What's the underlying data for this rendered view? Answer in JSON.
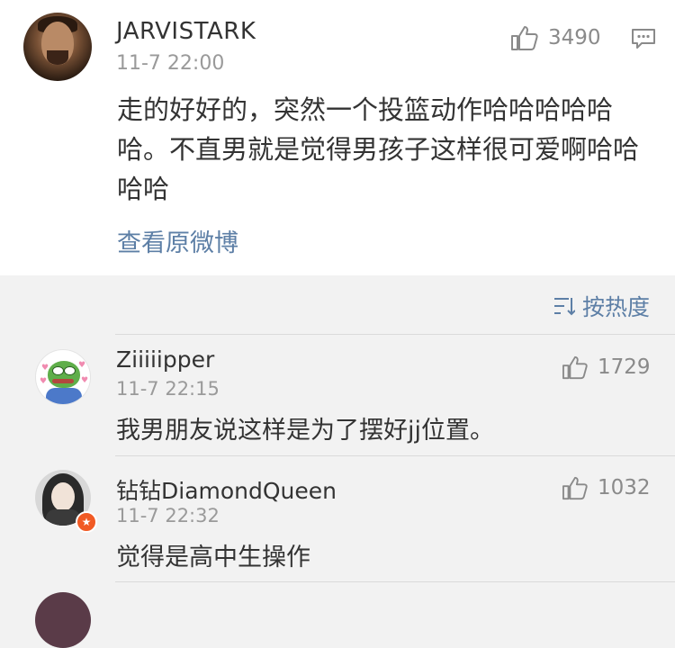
{
  "main_post": {
    "username": "JARVISTARK",
    "timestamp": "11-7 22:00",
    "likes": "3490",
    "text": "走的好好的，突然一个投篮动作哈哈哈哈哈哈。不直男就是觉得男孩子这样很可爱啊哈哈哈哈",
    "view_original": "查看原微博",
    "icons": {
      "like": "thumbs-up-icon",
      "comment": "comment-icon"
    }
  },
  "sort": {
    "label": "按热度",
    "icon": "sort-icon"
  },
  "comments": [
    {
      "username": "Ziiiiipper",
      "timestamp": "11-7 22:15",
      "likes": "1729",
      "text": "我男朋友说这样是为了摆好jj位置。"
    },
    {
      "username": "钻钻DiamondQueen",
      "timestamp": "11-7 22:32",
      "likes": "1032",
      "text": "觉得是高中生操作"
    }
  ],
  "colors": {
    "link": "#5d7fa6",
    "muted": "#9a9a9a",
    "text": "#333333",
    "background": "#f2f2f2",
    "vip_badge": "#f15a24"
  }
}
